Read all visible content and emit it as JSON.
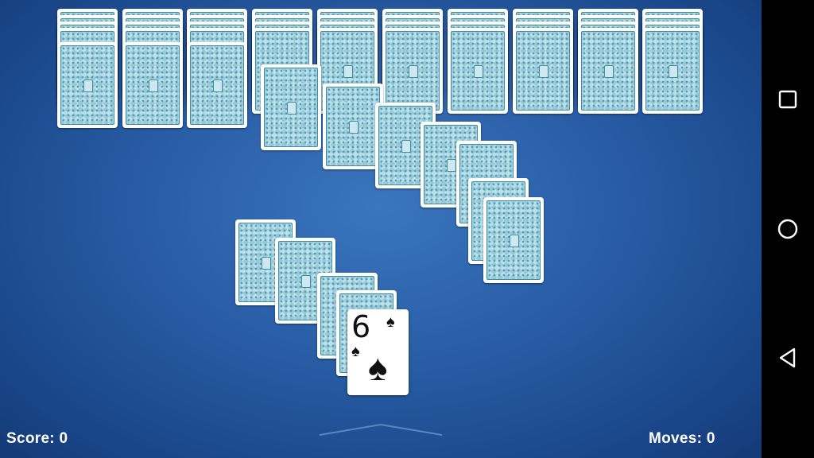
{
  "game": {
    "score_label": "Score: 0",
    "moves_label": "Moves: 0",
    "face_card": {
      "rank": "6",
      "suit": "♠",
      "suit_name": "spades"
    }
  },
  "navbar": {
    "buttons": [
      "recents-button",
      "home-button",
      "back-button"
    ]
  },
  "colors": {
    "table": "#2a5fa8",
    "card_back": "#bfe0ea",
    "card_pattern": "#4f9fb6",
    "navbar": "#000000"
  }
}
